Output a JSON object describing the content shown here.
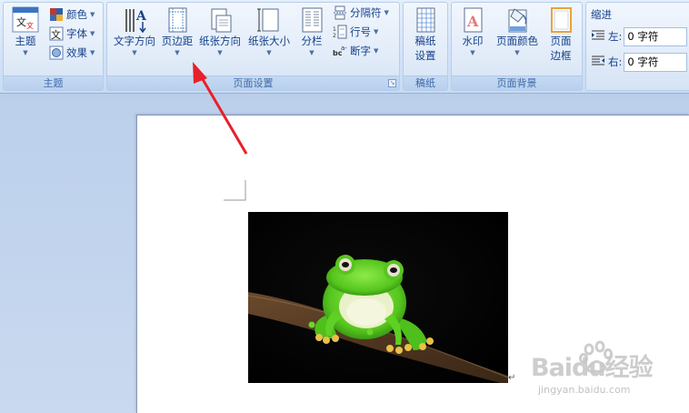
{
  "ribbon": {
    "theme_group": {
      "label": "主题",
      "theme_button": "主题",
      "colors": "颜色",
      "fonts": "字体",
      "effects": "效果"
    },
    "page_setup_group": {
      "label": "页面设置",
      "text_direction": "文字方向",
      "margins": "页边距",
      "orientation": "纸张方向",
      "size": "纸张大小",
      "columns": "分栏",
      "breaks": "分隔符",
      "line_numbers": "行号",
      "hyphenation": "断字"
    },
    "manuscript_group": {
      "label": "稿纸",
      "button_line1": "稿纸",
      "button_line2": "设置"
    },
    "page_background_group": {
      "label": "页面背景",
      "watermark": "水印",
      "page_color": "页面颜色",
      "page_borders_line1": "页面",
      "page_borders_line2": "边框"
    },
    "paragraph_group": {
      "indent_title": "缩进",
      "left_label": "左:",
      "left_value": "0 字符",
      "right_label": "右:",
      "right_value": "0 字符"
    }
  },
  "document": {
    "image_desc": "green-tree-frog-on-branch",
    "paragraph_mark": "↵"
  },
  "watermark": {
    "brand": "Baidu经验",
    "url": "jingyan.baidu.com"
  },
  "colors": {
    "annotation_arrow": "#e8202a",
    "ribbon_text": "#15428b",
    "frog_green": "#5cd12a"
  },
  "icons": [
    "theme-icon",
    "colors-icon",
    "fonts-icon",
    "effects-icon",
    "text-direction-icon",
    "margins-icon",
    "orientation-icon",
    "size-icon",
    "columns-icon",
    "breaks-icon",
    "line-numbers-icon",
    "hyphenation-icon",
    "manuscript-icon",
    "watermark-icon",
    "page-color-icon",
    "page-borders-icon",
    "indent-left-icon",
    "indent-right-icon"
  ]
}
